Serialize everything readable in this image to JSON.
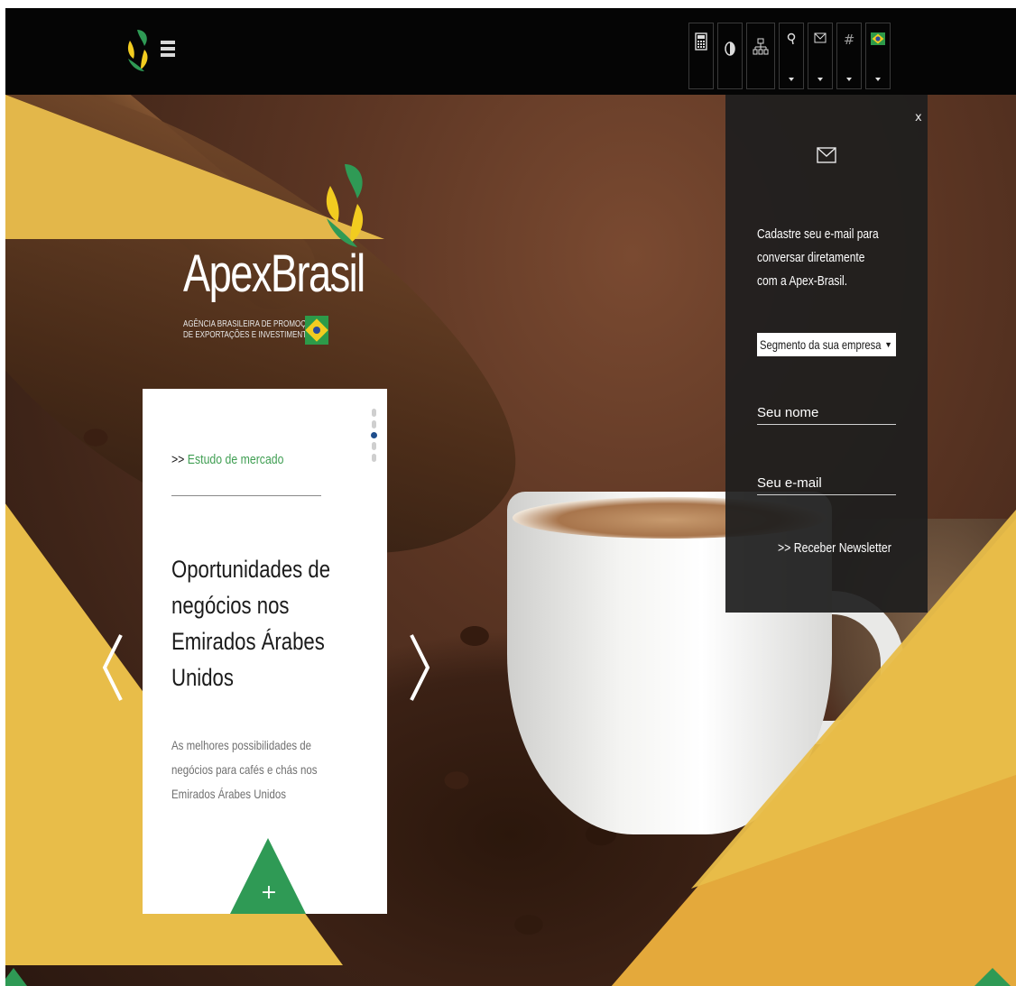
{
  "brand": {
    "name": "ApexBrasil",
    "subtitle_line1": "Agência Brasileira de Promoção",
    "subtitle_line2": "de Exportações e Investimentos"
  },
  "header": {
    "tools": [
      {
        "icon": "calculator-icon"
      },
      {
        "icon": "contrast-icon"
      },
      {
        "icon": "sitemap-icon"
      },
      {
        "icon": "search-icon",
        "dropdown": true
      },
      {
        "icon": "mail-icon",
        "dropdown": true
      },
      {
        "icon": "hashtag-icon",
        "dropdown": true
      },
      {
        "icon": "brazil-flag-icon",
        "dropdown": true
      }
    ]
  },
  "card": {
    "tag_prefix": ">>",
    "tag": "Estudo de mercado",
    "title": "Oportunidades de negócios nos Emirados Árabes Unidos",
    "description": "As melhores possibilidades de negócios para cafés e chás nos Emirados Árabes Unidos",
    "plus": "+",
    "slide_count": 5,
    "active_slide": 3
  },
  "newsletter": {
    "close": "x",
    "text": "Cadastre seu e-mail para conversar diretamente com a Apex-Brasil.",
    "segment_placeholder": "Segmento da sua empresa",
    "name_placeholder": "Seu nome",
    "email_placeholder": "Seu e-mail",
    "submit": ">> Receber Newsletter"
  },
  "colors": {
    "green": "#2f9a55",
    "yellow": "#e8bd49",
    "orange": "#e4a93b",
    "topbar": "#050505"
  }
}
